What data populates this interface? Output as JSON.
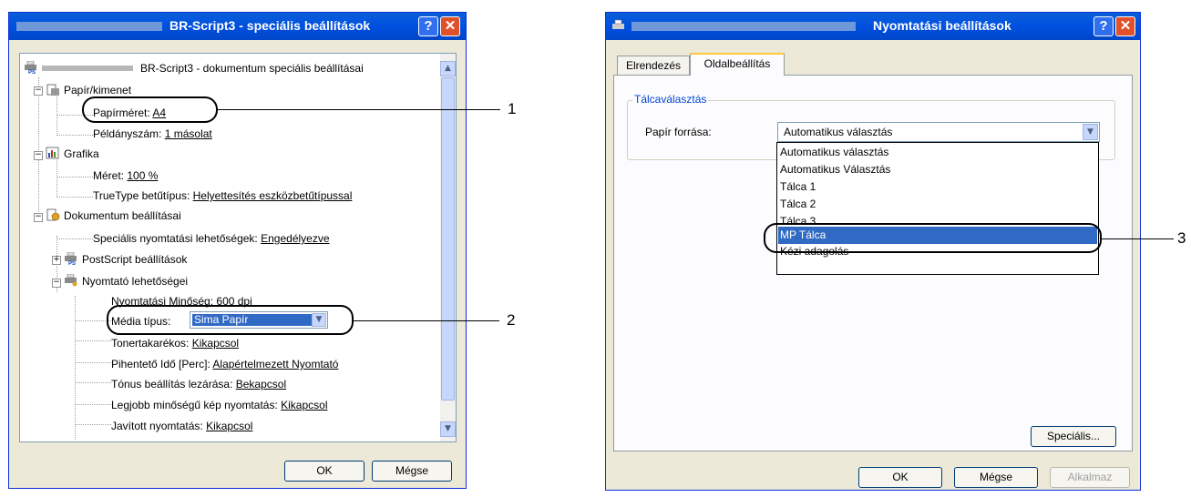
{
  "left_dialog": {
    "title": "BR-Script3 - speciális beállítások",
    "help_btn": "?",
    "close_btn": "✕",
    "tree": {
      "root": "BR-Script3 - dokumentum speciális beállításai",
      "paper_output": "Papír/kimenet",
      "paper_size_label": "Papírméret:",
      "paper_size_value": "A4",
      "copies_label": "Példányszám:",
      "copies_value": "1 másolat",
      "graphics": "Grafika",
      "size_label": "Méret:",
      "size_value": "100 %",
      "truetype_label": "TrueType betűtípus:",
      "truetype_value": "Helyettesítés eszközbetűtípussal",
      "doc_settings": "Dokumentum beállításai",
      "special_print_label": "Speciális nyomtatási lehetőségek:",
      "special_print_value": "Engedélyezve",
      "postscript": "PostScript beállítások",
      "printer_features": "Nyomtató lehetőségei",
      "quality_label": "Nyomtatási Minőség:",
      "quality_value": "600 dpi",
      "media_label": "Média típus:",
      "media_value": "Sima Papír",
      "toner_label": "Tonertakarékos:",
      "toner_value": "Kikapcsol",
      "sleep_label": "Pihentető Idő [Perc]:",
      "sleep_value": "Alapértelmezett Nyomtató",
      "tone_label": "Tónus beállítás lezárása:",
      "tone_value": "Bekapcsol",
      "best_label": "Legjobb minőségű kép nyomtatás:",
      "best_value": "Kikapcsol",
      "improved_label": "Javított nyomtatás:",
      "improved_value": "Kikapcsol"
    },
    "ok": "OK",
    "cancel": "Mégse"
  },
  "right_dialog": {
    "title": "Nyomtatási beállítások",
    "help_btn": "?",
    "close_btn": "✕",
    "tabs": [
      "Elrendezés",
      "Oldalbeállítás"
    ],
    "group_label": "Tálcaválasztás",
    "source_label": "Papír forrása:",
    "source_value": "Automatikus választás",
    "options": [
      "Automatikus választás",
      "Automatikus Választás",
      "Tálca 1",
      "Tálca 2",
      "Tálca 3",
      "MP Tálca",
      "Kézi adagolás"
    ],
    "selected_option": "MP Tálca",
    "special_btn": "Speciális...",
    "ok": "OK",
    "cancel": "Mégse",
    "apply": "Alkalmaz"
  },
  "callouts": [
    "1",
    "2",
    "3"
  ]
}
